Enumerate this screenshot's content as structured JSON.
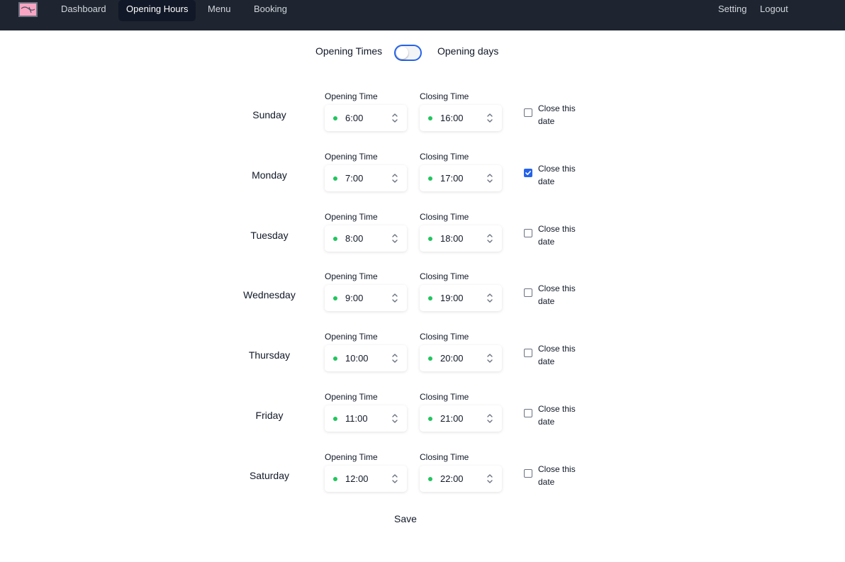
{
  "nav": {
    "items": [
      {
        "label": "Dashboard"
      },
      {
        "label": "Opening Hours"
      },
      {
        "label": "Menu"
      },
      {
        "label": "Booking"
      }
    ],
    "right": [
      {
        "label": "Setting"
      },
      {
        "label": "Logout"
      }
    ],
    "logo_icon": "logo-icon"
  },
  "toggle": {
    "left_label": "Opening Times",
    "right_label": "Opening days",
    "on": false
  },
  "labels": {
    "opening": "Opening Time",
    "closing": "Closing Time",
    "close_date": "Close this date"
  },
  "days": [
    {
      "name": "Sunday",
      "open": "6:00",
      "close": "16:00",
      "closed": false
    },
    {
      "name": "Monday",
      "open": "7:00",
      "close": "17:00",
      "closed": true
    },
    {
      "name": "Tuesday",
      "open": "8:00",
      "close": "18:00",
      "closed": false
    },
    {
      "name": "Wednesday",
      "open": "9:00",
      "close": "19:00",
      "closed": false
    },
    {
      "name": "Thursday",
      "open": "10:00",
      "close": "20:00",
      "closed": false
    },
    {
      "name": "Friday",
      "open": "11:00",
      "close": "21:00",
      "closed": false
    },
    {
      "name": "Saturday",
      "open": "12:00",
      "close": "22:00",
      "closed": false
    }
  ],
  "save_label": "Save",
  "colors": {
    "nav_bg": "#1f2530",
    "accent": "#2563eb",
    "status_dot": "#22c55e"
  }
}
